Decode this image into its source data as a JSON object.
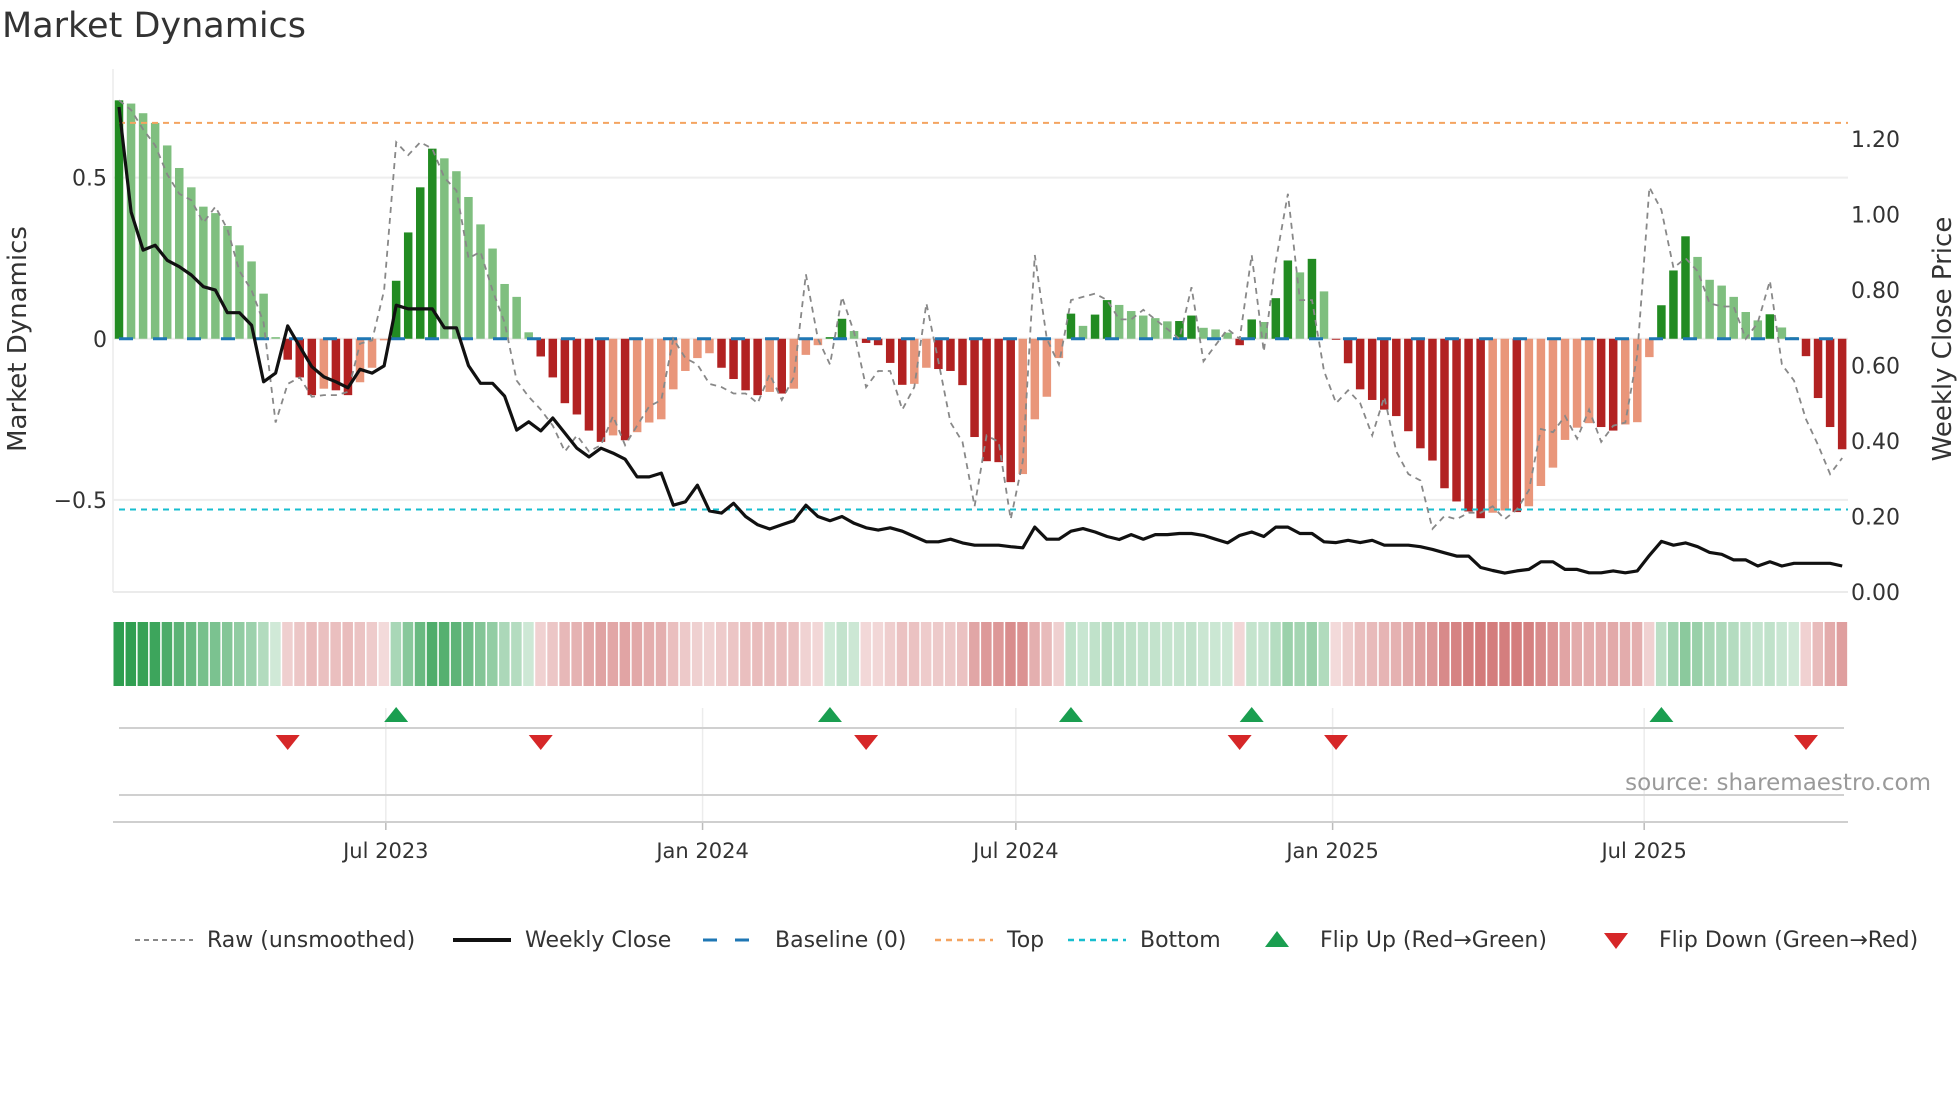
{
  "title": "Market Dynamics",
  "source": "source: sharemaestro.com",
  "chart_data": {
    "type": "bar",
    "title": "Market Dynamics",
    "ylabel": "Market Dynamics",
    "y2label": "Weekly Close Price",
    "start_date": "2023-01-27",
    "step_days": 7,
    "ylim": [
      -0.786,
      0.8
    ],
    "y2lim": [
      0,
      1.354
    ],
    "yticks": [
      {
        "v": 0.5,
        "label": "0.5"
      },
      {
        "v": 0,
        "label": "0"
      },
      {
        "v": -0.5,
        "label": "−0.5"
      }
    ],
    "y2ticks": [
      {
        "v": 0,
        "label": "0.00"
      },
      {
        "v": 0.2,
        "label": "0.20"
      },
      {
        "v": 0.4,
        "label": "0.40"
      },
      {
        "v": 0.6,
        "label": "0.60"
      },
      {
        "v": 0.8,
        "label": "0.80"
      },
      {
        "v": 1.0,
        "label": "1.00"
      },
      {
        "v": 1.2,
        "label": "1.20"
      }
    ],
    "x_ticks": [
      {
        "date": "2023-07-01",
        "label": "Jul 2023"
      },
      {
        "date": "2024-01-01",
        "label": "Jan 2024"
      },
      {
        "date": "2024-07-01",
        "label": "Jul 2024"
      },
      {
        "date": "2025-01-01",
        "label": "Jan 2025"
      },
      {
        "date": "2025-07-01",
        "label": "Jul 2025"
      }
    ],
    "top_level": 0.67,
    "bottom_level": -0.53,
    "baseline": 0,
    "colors": {
      "up_strong": "#228b22",
      "up_weak": "#7fbf7f",
      "down_strong": "#b22222",
      "down_weak": "#e9967a",
      "strip_green": "#2e9e4f",
      "strip_red": "#c85a5a",
      "raw": "#888888",
      "close": "#111111",
      "baseline": "#1f77b4",
      "top": "#f4a460",
      "bottom": "#17becf",
      "flip_up": "#1a9e50",
      "flip_down": "#d62728"
    },
    "series": [
      {
        "name": "Market Dynamics (smoothed)",
        "values": [
          0.74,
          0.73,
          0.7,
          0.67,
          0.6,
          0.53,
          0.47,
          0.41,
          0.39,
          0.35,
          0.29,
          0.24,
          0.14,
          0.005,
          -0.065,
          -0.12,
          -0.175,
          -0.155,
          -0.16,
          -0.175,
          -0.135,
          -0.09,
          -0.005,
          0.18,
          0.33,
          0.47,
          0.59,
          0.56,
          0.52,
          0.44,
          0.355,
          0.28,
          0.17,
          0.13,
          0.02,
          -0.055,
          -0.12,
          -0.2,
          -0.235,
          -0.285,
          -0.32,
          -0.3,
          -0.315,
          -0.29,
          -0.26,
          -0.25,
          -0.157,
          -0.1,
          -0.06,
          -0.045,
          -0.09,
          -0.125,
          -0.16,
          -0.175,
          -0.165,
          -0.17,
          -0.155,
          -0.05,
          -0.02,
          0.005,
          0.062,
          0.024,
          -0.013,
          -0.02,
          -0.075,
          -0.143,
          -0.14,
          -0.09,
          -0.094,
          -0.1,
          -0.144,
          -0.305,
          -0.38,
          -0.383,
          -0.445,
          -0.42,
          -0.25,
          -0.18,
          -0.06,
          0.078,
          0.04,
          0.075,
          0.12,
          0.105,
          0.086,
          0.072,
          0.064,
          0.054,
          0.055,
          0.072,
          0.034,
          0.029,
          0.019,
          -0.02,
          0.06,
          0.052,
          0.126,
          0.243,
          0.206,
          0.248,
          0.147,
          -0.003,
          -0.076,
          -0.157,
          -0.19,
          -0.22,
          -0.24,
          -0.287,
          -0.34,
          -0.378,
          -0.464,
          -0.505,
          -0.536,
          -0.557,
          -0.54,
          -0.533,
          -0.538,
          -0.52,
          -0.457,
          -0.4,
          -0.314,
          -0.276,
          -0.262,
          -0.274,
          -0.285,
          -0.266,
          -0.259,
          -0.057,
          0.104,
          0.212,
          0.318,
          0.254,
          0.183,
          0.165,
          0.13,
          0.083,
          0.057,
          0.076,
          0.035,
          0.005,
          -0.054,
          -0.184,
          -0.274,
          -0.343
        ]
      },
      {
        "name": "Raw (unsmoothed)",
        "values": [
          0.74,
          0.71,
          0.65,
          0.6,
          0.51,
          0.45,
          0.43,
          0.36,
          0.41,
          0.34,
          0.21,
          0.15,
          0.05,
          -0.26,
          -0.14,
          -0.12,
          -0.18,
          -0.175,
          -0.175,
          -0.165,
          -0.015,
          -0.005,
          0.15,
          0.61,
          0.57,
          0.61,
          0.59,
          0.5,
          0.46,
          0.25,
          0.27,
          0.15,
          0.05,
          -0.13,
          -0.18,
          -0.22,
          -0.27,
          -0.35,
          -0.3,
          -0.35,
          -0.33,
          -0.24,
          -0.33,
          -0.27,
          -0.21,
          -0.19,
          0.0,
          -0.06,
          -0.08,
          -0.14,
          -0.15,
          -0.17,
          -0.17,
          -0.2,
          -0.11,
          -0.19,
          -0.12,
          0.2,
          0.0,
          -0.08,
          0.13,
          0.02,
          -0.15,
          -0.1,
          -0.1,
          -0.22,
          -0.15,
          0.11,
          -0.07,
          -0.26,
          -0.32,
          -0.52,
          -0.3,
          -0.32,
          -0.56,
          -0.38,
          0.26,
          0.0,
          -0.08,
          0.12,
          0.13,
          0.14,
          0.12,
          0.06,
          0.06,
          0.09,
          0.06,
          0.03,
          0.0,
          0.16,
          -0.07,
          -0.02,
          0.03,
          0.0,
          0.26,
          -0.04,
          0.24,
          0.45,
          0.12,
          0.12,
          -0.1,
          -0.2,
          -0.16,
          -0.2,
          -0.3,
          -0.18,
          -0.35,
          -0.42,
          -0.44,
          -0.59,
          -0.55,
          -0.56,
          -0.54,
          -0.54,
          -0.52,
          -0.56,
          -0.53,
          -0.47,
          -0.28,
          -0.29,
          -0.24,
          -0.31,
          -0.22,
          -0.32,
          -0.27,
          -0.26,
          -0.05,
          0.47,
          0.4,
          0.22,
          0.25,
          0.21,
          0.11,
          0.1,
          0.1,
          0.0,
          0.05,
          0.18,
          -0.08,
          -0.13,
          -0.25,
          -0.33,
          -0.42,
          -0.37
        ]
      },
      {
        "name": "Weekly Close",
        "axis": "right",
        "values": [
          1.285,
          1.007,
          0.906,
          0.919,
          0.879,
          0.862,
          0.84,
          0.809,
          0.8,
          0.74,
          0.74,
          0.707,
          0.557,
          0.58,
          0.705,
          0.65,
          0.597,
          0.57,
          0.557,
          0.541,
          0.59,
          0.58,
          0.599,
          0.76,
          0.75,
          0.75,
          0.75,
          0.7,
          0.7,
          0.6,
          0.553,
          0.553,
          0.519,
          0.429,
          0.451,
          0.427,
          0.461,
          0.421,
          0.381,
          0.358,
          0.381,
          0.368,
          0.352,
          0.305,
          0.305,
          0.315,
          0.23,
          0.239,
          0.283,
          0.215,
          0.209,
          0.235,
          0.2,
          0.178,
          0.167,
          0.178,
          0.189,
          0.23,
          0.2,
          0.189,
          0.2,
          0.182,
          0.17,
          0.164,
          0.17,
          0.161,
          0.147,
          0.133,
          0.133,
          0.14,
          0.13,
          0.124,
          0.124,
          0.124,
          0.12,
          0.117,
          0.172,
          0.14,
          0.14,
          0.161,
          0.168,
          0.159,
          0.147,
          0.139,
          0.152,
          0.14,
          0.152,
          0.152,
          0.155,
          0.155,
          0.15,
          0.14,
          0.13,
          0.15,
          0.159,
          0.147,
          0.172,
          0.172,
          0.155,
          0.155,
          0.133,
          0.131,
          0.137,
          0.131,
          0.137,
          0.124,
          0.124,
          0.124,
          0.12,
          0.113,
          0.104,
          0.095,
          0.095,
          0.065,
          0.057,
          0.05,
          0.056,
          0.06,
          0.08,
          0.08,
          0.06,
          0.06,
          0.051,
          0.051,
          0.056,
          0.051,
          0.056,
          0.097,
          0.134,
          0.124,
          0.13,
          0.12,
          0.105,
          0.1,
          0.085,
          0.085,
          0.069,
          0.08,
          0.069,
          0.076,
          0.076,
          0.076,
          0.076,
          0.069
        ]
      }
    ],
    "flip_up_weeks": [
      24,
      60,
      80,
      95,
      129
    ],
    "flip_down_weeks": [
      15,
      36,
      63,
      94,
      102,
      141
    ],
    "legend": {
      "position": "bottom",
      "items": [
        {
          "key": "raw",
          "label": "Raw (unsmoothed)"
        },
        {
          "key": "close",
          "label": "Weekly Close"
        },
        {
          "key": "baseline",
          "label": "Baseline (0)"
        },
        {
          "key": "top",
          "label": "Top"
        },
        {
          "key": "bottom",
          "label": "Bottom"
        },
        {
          "key": "flip_up",
          "label": "Flip Up (Red→Green)"
        },
        {
          "key": "flip_down",
          "label": "Flip Down (Green→Red)"
        }
      ]
    }
  }
}
